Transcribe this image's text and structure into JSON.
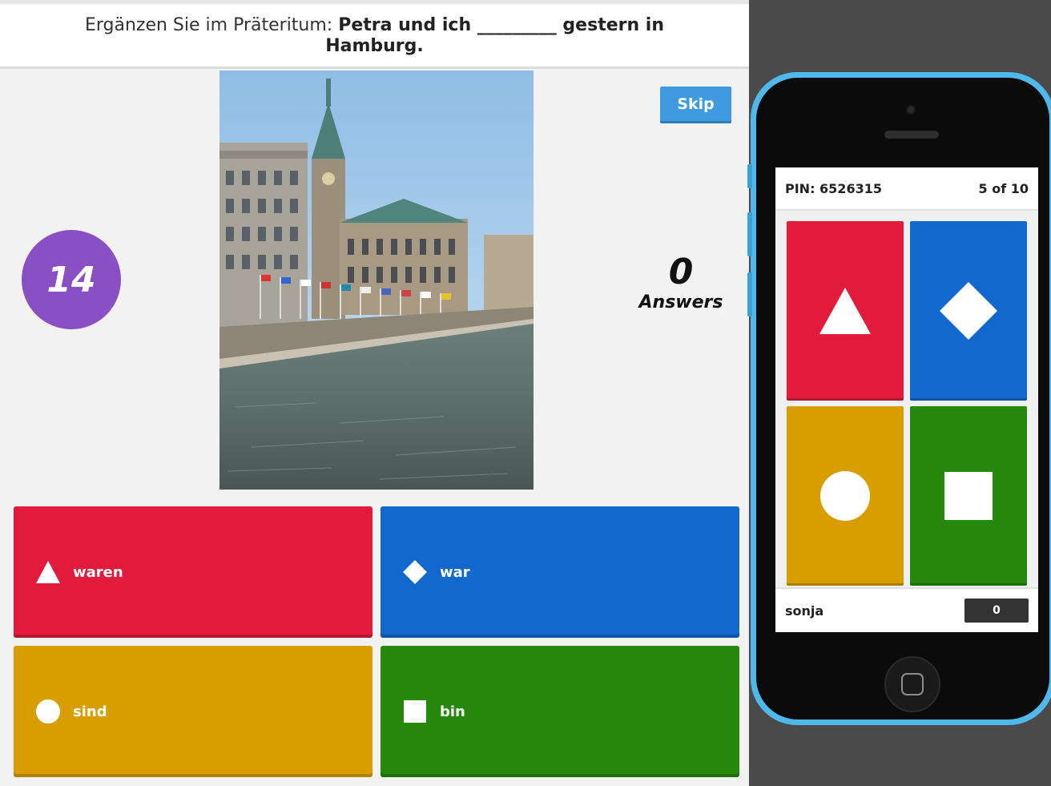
{
  "question": {
    "prefix": "Ergänzen Sie im Präteritum: ",
    "bold": "Petra und ich _________ gestern in Hamburg."
  },
  "timer": {
    "value": "14"
  },
  "skip_label": "Skip",
  "answers_count": {
    "value": "0",
    "label": "Answers"
  },
  "answers": [
    {
      "label": "waren",
      "shape": "triangle-icon",
      "color": "#e21b3c"
    },
    {
      "label": "war",
      "shape": "diamond-icon",
      "color": "#1368ce"
    },
    {
      "label": "sind",
      "shape": "circle-icon",
      "color": "#d89e00"
    },
    {
      "label": "bin",
      "shape": "square-icon",
      "color": "#26890c"
    }
  ],
  "phone": {
    "pin": "PIN: 6526315",
    "progress": "5 of 10",
    "player_name": "sonja",
    "score": "0"
  },
  "colors": {
    "timer": "#8a4fc4",
    "skip": "#3f9ae0",
    "phone_frame": "#4fb9ec"
  }
}
